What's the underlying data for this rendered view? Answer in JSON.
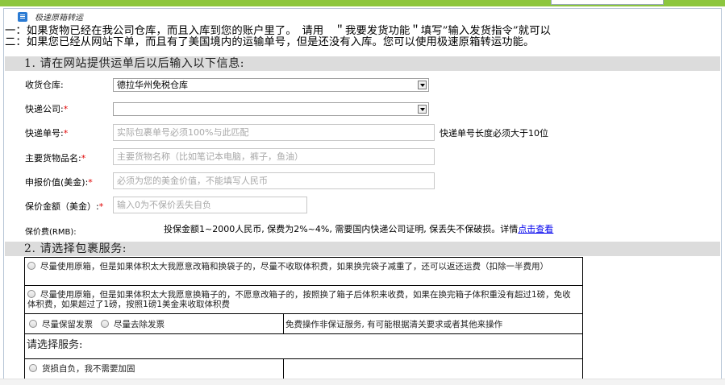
{
  "header": {
    "title": "极速原箱转运",
    "icon": "list-icon"
  },
  "intro": {
    "line1": "一：如果货物已经在我公司仓库，而且入库到您的账户里了。　请用　＂我要发货功能＂填写”输入发货指令”就可以",
    "line2": "二：如果您已经从网站下单，而且有了美国境内的运输单号，但是还没有入库。您可以使用极速原箱转运功能。"
  },
  "section1": {
    "title": "1. 请在网站提供运单后以后输入以下信息:",
    "warehouse": {
      "label": "收货仓库:",
      "value": "德拉华州免税仓库"
    },
    "courier": {
      "label": "快递公司:",
      "required": "*",
      "value": ""
    },
    "tracking": {
      "label": "快递单号:",
      "required": "*",
      "placeholder": "实际包裹单号必须100%与此匹配",
      "hint": "快递单号长度必须大于10位"
    },
    "goods": {
      "label": "主要货物品名:",
      "required": "*",
      "placeholder": "主要货物名称（比如笔记本电脑，裤子，鱼油）"
    },
    "declared": {
      "label": "申报价值(美金):",
      "required": "*",
      "placeholder": "必须为您的美金价值，不能填写人民币"
    },
    "insured": {
      "label": "保价金额（美金）:",
      "required": "*",
      "placeholder": "输入0为不保价丢失自负"
    },
    "fee": {
      "label": "保价费(RMB):",
      "text": "投保金额1~2000人民币, 保费为2%~4%, 需要国内快递公司证明, 保丢失不保破损。详情",
      "link": "点击查看"
    }
  },
  "section2": {
    "title": "2. 请选择包裹服务:",
    "option1": "尽量使用原箱，但是如果体积太大我愿意改箱和换袋子的，尽量不收取体积费，如果换完袋子减重了，还可以返还运费（扣除一半费用）",
    "option2": "尽量使用原箱，但是如果体积太大我愿意换箱子的，不愿意改箱子的，按照换了箱子后体积来收费，如果在换完箱子体积重没有超过1磅，免收体积费，如果超过了1磅，按照1磅1美金来收取体积费",
    "invoice_keep": "尽量保留发票",
    "invoice_remove": "尽量去除发票",
    "invoice_note": "免费操作非保证服务, 有可能根据清关要求或者其他来操作",
    "service_title": "请选择服务:",
    "no_reinforce": "货损自负，我不需要加固"
  }
}
